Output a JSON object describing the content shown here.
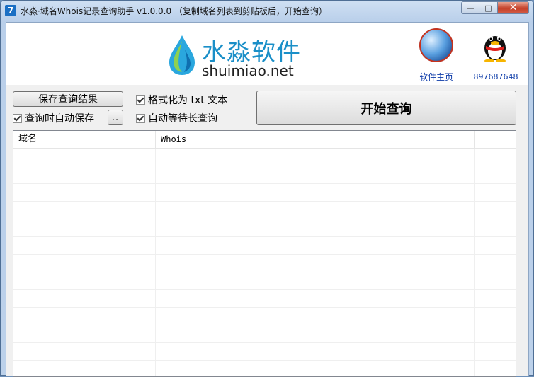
{
  "window": {
    "icon_glyph": "7",
    "title": "水淼·域名Whois记录查询助手 v1.0.0.0  （复制域名列表到剪贴板后，开始查询）",
    "minimize": "—",
    "maximize": "□",
    "close": "✕"
  },
  "banner": {
    "logo_cn": "水淼软件",
    "logo_en": "shuimiao.net",
    "home_link": "软件主页",
    "qq_link": "897687648",
    "icons": [
      "water-drop-logo-icon",
      "globe-icon",
      "qq-penguin-icon"
    ]
  },
  "controls": {
    "save_button": "保存查询结果",
    "autosave_label": "查询时自动保存",
    "autosave_checked": true,
    "browse_button": "..",
    "format_label": "格式化为 txt 文本",
    "format_checked": true,
    "wait_label": "自动等待长查询",
    "wait_checked": true,
    "start_button": "开始查询"
  },
  "list": {
    "columns": [
      "域名",
      "Whois",
      ""
    ],
    "rows": []
  },
  "colors": {
    "titlebar": "#bcd1ea",
    "logo_blue": "#1a8fc8",
    "link": "#0b3aa8",
    "close_button": "#c4412a"
  }
}
